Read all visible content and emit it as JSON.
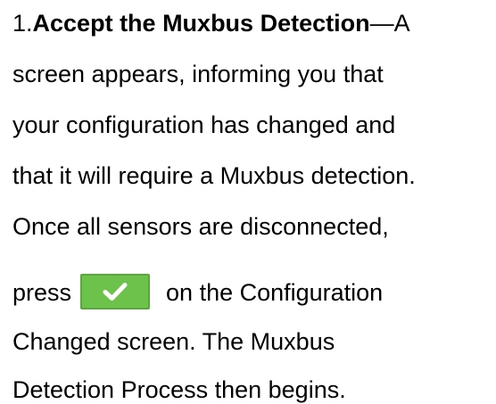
{
  "step": {
    "number": "1.",
    "title": "Accept the Muxbus Detection",
    "lines": [
      "—A",
      "screen appears, informing you that",
      "your configuration has changed and",
      "that it will require a Muxbus detection.",
      "Once all sensors are disconnected,"
    ],
    "press_prefix": "press",
    "press_suffix": "on the Configuration",
    "tail_lines": [
      "Changed screen. The Muxbus",
      "Detection Process then begins."
    ]
  },
  "confirm_button": {
    "icon": "checkmark-icon",
    "color": "#6cc24a",
    "border_color": "#58a83c",
    "icon_color": "#ffffff"
  }
}
